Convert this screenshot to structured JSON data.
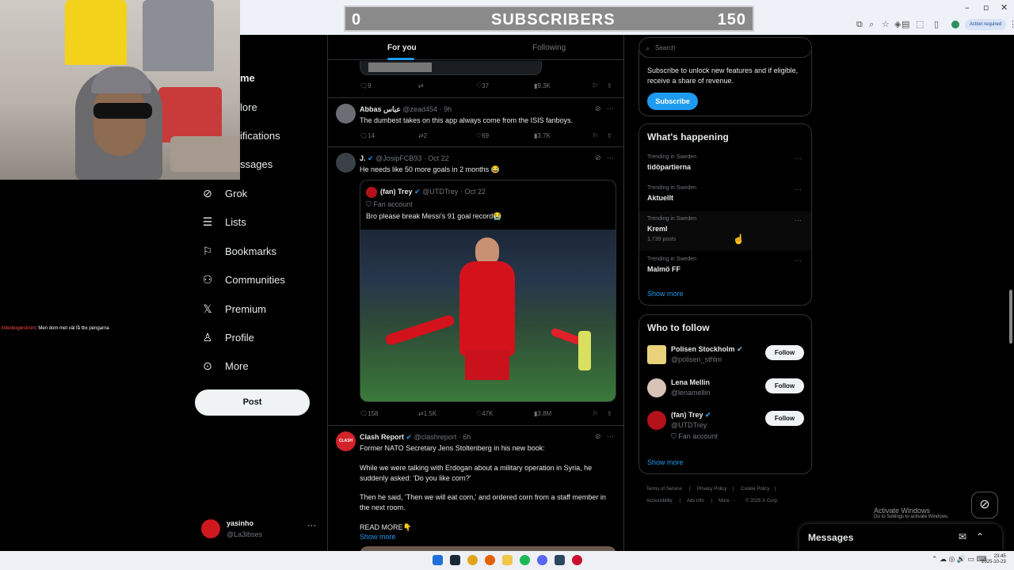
{
  "overlay": {
    "left_count": "0",
    "title": "SUBSCRIBERS",
    "right_count": "150"
  },
  "browser": {
    "action_required": "Action required",
    "window_controls": [
      "–",
      "▫",
      "✕"
    ]
  },
  "chat": {
    "user": "linbobogerstrom",
    "message": ": Men dom met väl få tbx pengarna"
  },
  "nav": {
    "clipped_items": [
      {
        "name": "home",
        "label": "me"
      },
      {
        "name": "explore",
        "label": "lore"
      },
      {
        "name": "notifications",
        "label": "ifications"
      },
      {
        "name": "messages",
        "label": "ssages"
      }
    ],
    "items": [
      {
        "name": "grok",
        "label": "Grok",
        "icon": "grok-icon"
      },
      {
        "name": "lists",
        "label": "Lists",
        "icon": "lists-icon"
      },
      {
        "name": "bookmarks",
        "label": "Bookmarks",
        "icon": "bookmark-icon"
      },
      {
        "name": "communities",
        "label": "Communities",
        "icon": "communities-icon"
      },
      {
        "name": "premium",
        "label": "Premium",
        "icon": "x-logo-icon"
      },
      {
        "name": "profile",
        "label": "Profile",
        "icon": "profile-icon"
      },
      {
        "name": "more",
        "label": "More",
        "icon": "more-circle-icon"
      }
    ],
    "post_label": "Post"
  },
  "account": {
    "display_name": "yasinho",
    "handle": "@La3ibses"
  },
  "feed": {
    "tabs": [
      "For you",
      "Following"
    ],
    "top_actions": {
      "replies": "9",
      "likes": "37",
      "views": "9.3K"
    },
    "tweet1": {
      "name": "Abbas عباس",
      "handle": "@zead454",
      "time": "9h",
      "text": "The dumbest takes on this app always come from the ISIS fanboys.",
      "replies": "14",
      "reposts": "2",
      "likes": "69",
      "views": "3.7K"
    },
    "tweet2": {
      "name": "J.",
      "handle": "@JosipFCB93",
      "time": "Oct 22",
      "text": "He needs like 50 more goals in 2 months 😂",
      "replies": "158",
      "reposts": "1.5K",
      "likes": "47K",
      "views": "3.8M",
      "quote": {
        "name": "(fan) Trey",
        "handle": "@UTDTrey",
        "time": "Oct 22",
        "label": "Fan account",
        "text": "Bro please break Messi's 91 goal record😭"
      }
    },
    "tweet3": {
      "name": "Clash Report",
      "handle": "@clashreport",
      "time": "6h",
      "lines": [
        "Former NATO Secretary Jens Stoltenberg in his new book:",
        "While we were talking with Erdogan about a military operation in Syria, he",
        "suddenly asked: 'Do you like corn?'",
        "Then he said, 'Then we will eat corn,' and ordered corn from a staff member in",
        "the next room.",
        "READ MORE👇"
      ],
      "show_more": "Show more",
      "logo_text": "CLASH"
    }
  },
  "sidebar": {
    "search_placeholder": "Search",
    "premium_text": [
      "Subscribe to unlock new features and if eligible,",
      "receive a share of revenue."
    ],
    "subscribe_label": "Subscribe",
    "happening_title": "What's happening",
    "trends": [
      {
        "context": "Trending in Sweden",
        "name": "tidöpartierna",
        "count": ""
      },
      {
        "context": "Trending in Sweden",
        "name": "Aktuellt",
        "count": ""
      },
      {
        "context": "Trending in Sweden",
        "name": "Kreml",
        "count": "1,739 posts"
      },
      {
        "context": "Trending in Sweden",
        "name": "Malmö FF",
        "count": ""
      }
    ],
    "show_more": "Show more",
    "wtf_title": "Who to follow",
    "wtf": [
      {
        "name": "Polisen Stockholm",
        "handle": "@polisen_sthlm",
        "extra": ""
      },
      {
        "name": "Lena Mellin",
        "handle": "@lenamellin",
        "extra": ""
      },
      {
        "name": "(fan) Trey",
        "handle": "@UTDTrey",
        "extra": "Fan account"
      }
    ],
    "follow_label": "Follow",
    "footer": [
      "Terms of Service",
      "Privacy Policy",
      "Cookie Policy",
      "Accessibility",
      "Ads info",
      "More ···",
      "© 2025 X Corp."
    ]
  },
  "windows": {
    "activate_title": "Activate Windows",
    "activate_sub": "Go to Settings to activate Windows.",
    "time": "23:45",
    "date": "2025-10-23"
  },
  "messages": {
    "title": "Messages"
  },
  "colors": {
    "accent": "#1d9bf0",
    "background": "#000000",
    "border": "#2f3336",
    "muted": "#71767b"
  }
}
